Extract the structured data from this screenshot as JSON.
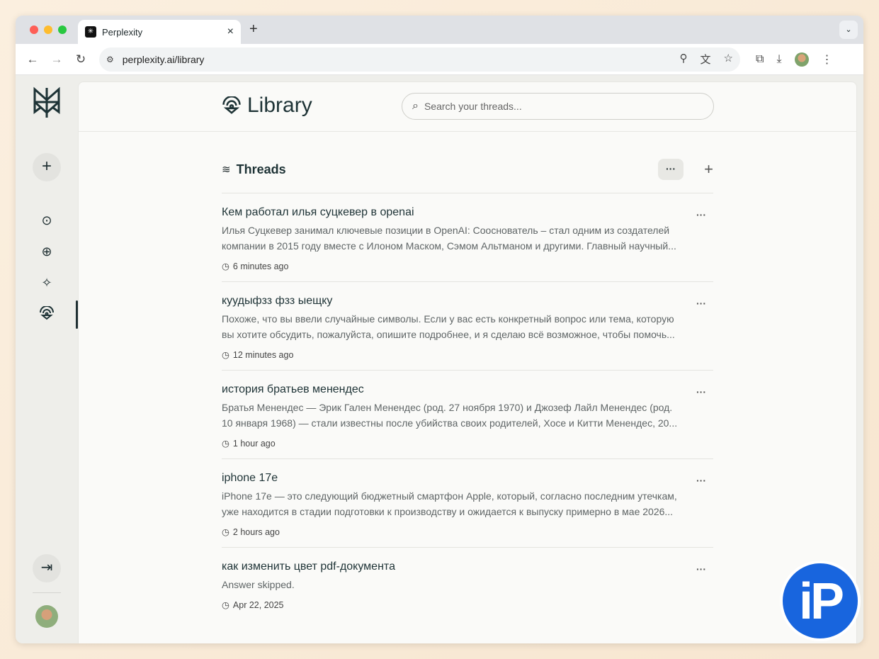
{
  "browser": {
    "tab_title": "Perplexity",
    "url": "perplexity.ai/library"
  },
  "header": {
    "title": "Library",
    "search_placeholder": "Search your threads..."
  },
  "threads": {
    "title": "Threads",
    "items": [
      {
        "question": "Кем работал илья суцкевер в openai",
        "answer": "Илья Суцкевер занимал ключевые позиции в OpenAI: Сооснователь – стал одним из создателей компании в 2015 году вместе с Илоном Маском, Сэмом Альтманом и другими. Главный научный...",
        "time": "6 minutes ago"
      },
      {
        "question": "куудыфзз фзз ыещку",
        "answer": "Похоже, что вы ввели случайные символы. Если у вас есть конкретный вопрос или тема, которую вы хотите обсудить, пожалуйста, опишите подробнее, и я сделаю всё возможное, чтобы помочь...",
        "time": "12 minutes ago"
      },
      {
        "question": "история братьев менендес",
        "answer": "Братья Менендес — Эрик Гален Менендес (род. 27 ноября 1970) и Джозеф Лайл Менендес (род. 10 января 1968) — стали известны после убийства своих родителей, Хосе и Китти Менендес, 20...",
        "time": "1 hour ago"
      },
      {
        "question": "iphone 17e",
        "answer": "iPhone 17e — это следующий бюджетный смартфон Apple, который, согласно последним утечкам, уже находится в стадии подготовки к производству и ожидается к выпуску примерно в мае 2026...",
        "time": "2 hours ago"
      },
      {
        "question": "как изменить цвет pdf-документа",
        "answer": "Answer skipped.",
        "time": "Apr 22, 2025"
      }
    ]
  },
  "watermark": {
    "text": "iP",
    "color": "#1865de"
  }
}
